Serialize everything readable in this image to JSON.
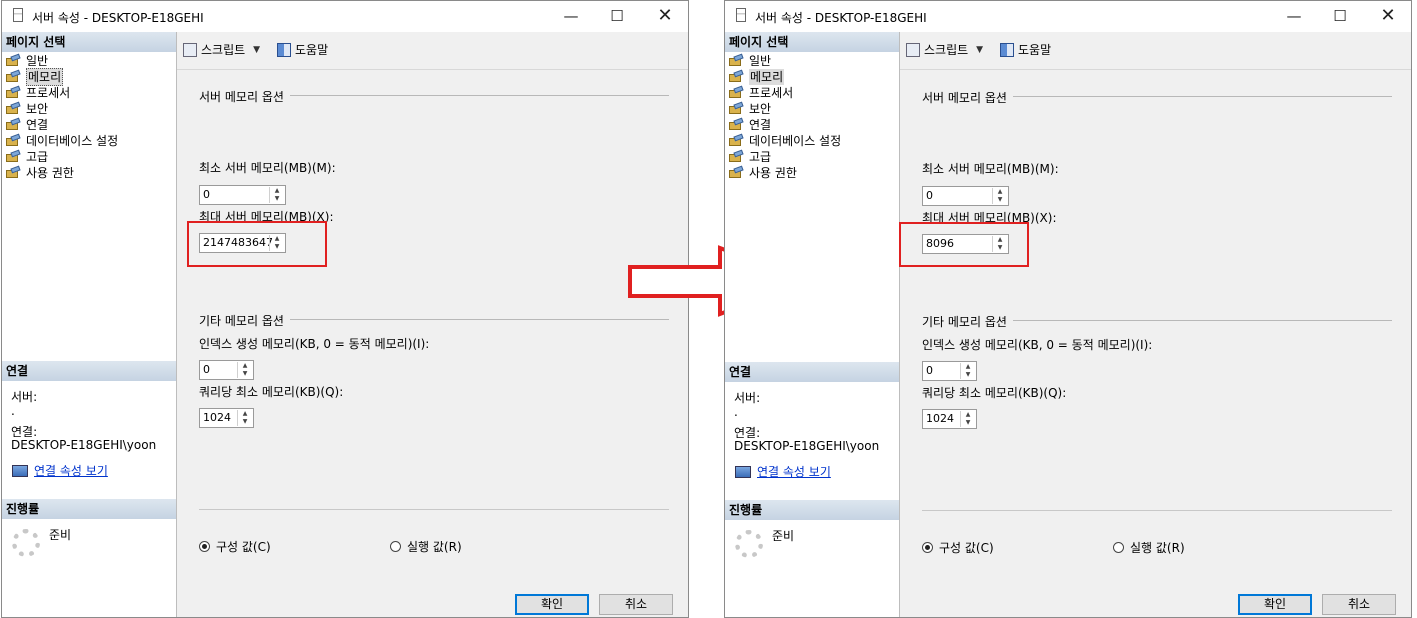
{
  "windows": [
    {
      "title": "서버 속성 - DESKTOP-E18GEHI",
      "page_select_header": "페이지 선택",
      "nav_items": [
        "일반",
        "메모리",
        "프로세서",
        "보안",
        "연결",
        "데이터베이스 설정",
        "고급",
        "사용 권한"
      ],
      "selected_nav": "메모리",
      "toolbar": {
        "script": "스크립트",
        "help": "도움말"
      },
      "server_memory_group": "서버 메모리 옵션",
      "min_label": "최소 서버 메모리(MB)(M):",
      "min_value": "0",
      "max_label": "최대 서버 메모리(MB)(X):",
      "max_value": "2147483647",
      "other_group": "기타 메모리 옵션",
      "index_label": "인덱스 생성 메모리(KB, 0 = 동적 메모리)(I):",
      "index_value": "0",
      "query_label": "쿼리당 최소 메모리(KB)(Q):",
      "query_value": "1024",
      "connection_header": "연결",
      "server_label": "서버:",
      "server_value": ".",
      "connection_label": "연결:",
      "connection_value": "DESKTOP-E18GEHI\\yoon",
      "view_conn_link": "연결 속성 보기",
      "progress_header": "진행률",
      "progress_status": "준비",
      "radio_configured": "구성 값(C)",
      "radio_running": "실행 값(R)",
      "ok": "확인",
      "cancel": "취소"
    },
    {
      "title": "서버 속성 - DESKTOP-E18GEHI",
      "page_select_header": "페이지 선택",
      "nav_items": [
        "일반",
        "메모리",
        "프로세서",
        "보안",
        "연결",
        "데이터베이스 설정",
        "고급",
        "사용 권한"
      ],
      "selected_nav": "메모리",
      "toolbar": {
        "script": "스크립트",
        "help": "도움말"
      },
      "server_memory_group": "서버 메모리 옵션",
      "min_label": "최소 서버 메모리(MB)(M):",
      "min_value": "0",
      "max_label": "최대 서버 메모리(MB)(X):",
      "max_value": "8096",
      "other_group": "기타 메모리 옵션",
      "index_label": "인덱스 생성 메모리(KB, 0 = 동적 메모리)(I):",
      "index_value": "0",
      "query_label": "쿼리당 최소 메모리(KB)(Q):",
      "query_value": "1024",
      "connection_header": "연결",
      "server_label": "서버:",
      "server_value": ".",
      "connection_label": "연결:",
      "connection_value": "DESKTOP-E18GEHI\\yoon",
      "view_conn_link": "연결 속성 보기",
      "progress_header": "진행률",
      "progress_status": "준비",
      "radio_configured": "구성 값(C)",
      "radio_running": "실행 값(R)",
      "ok": "확인",
      "cancel": "취소"
    }
  ],
  "colors": {
    "highlight": "#e02020",
    "link": "#0033cc",
    "section_header": "#c5d3e2"
  }
}
